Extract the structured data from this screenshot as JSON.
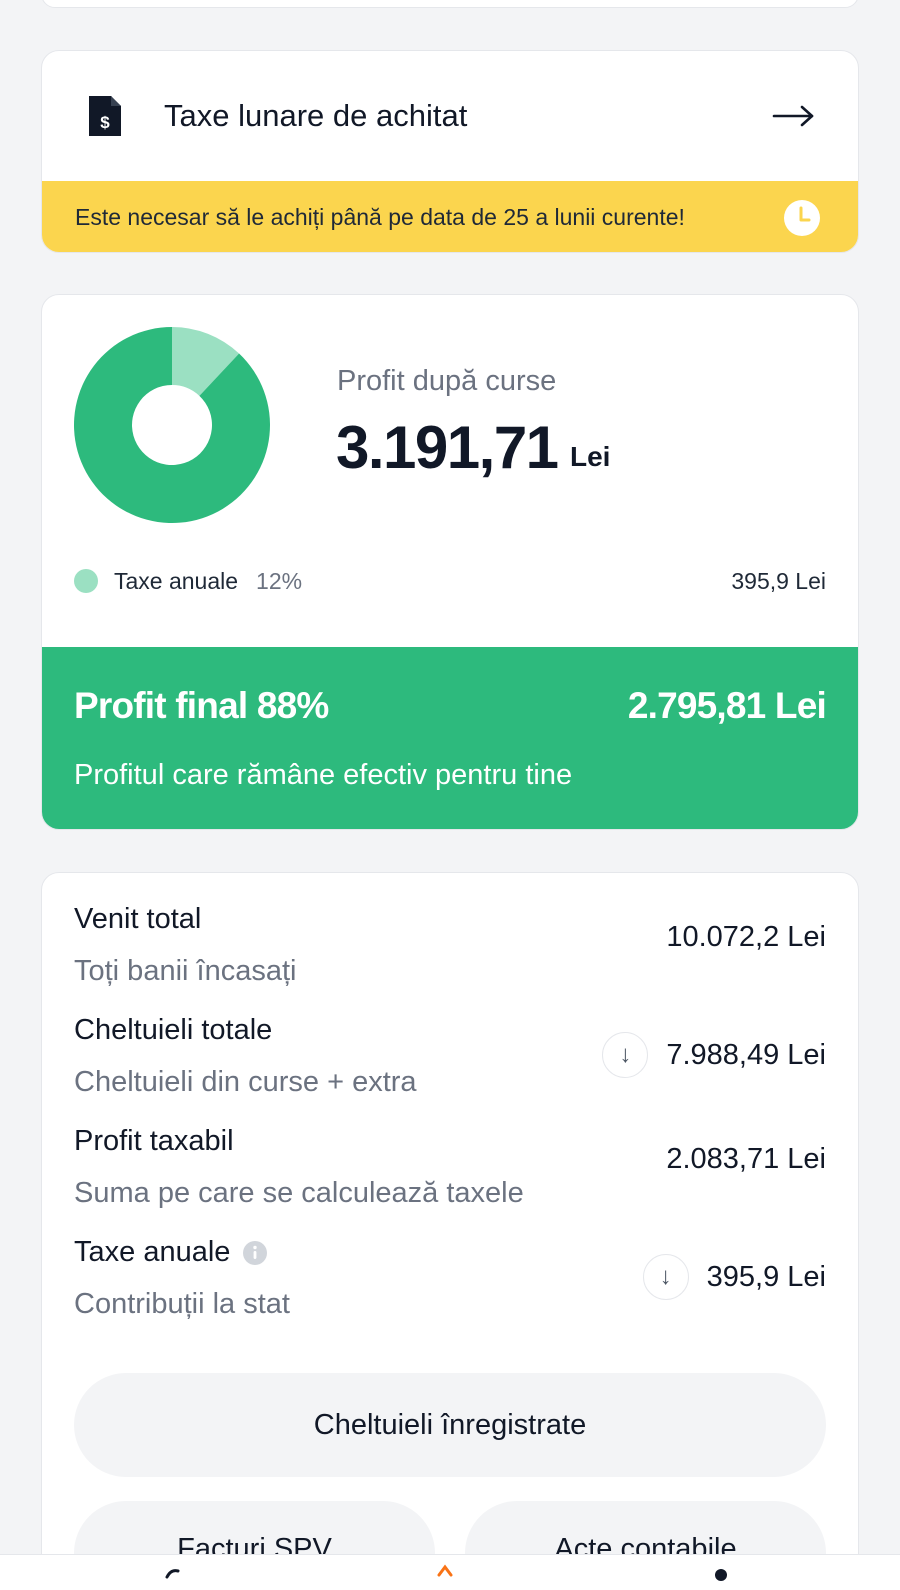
{
  "tax_card": {
    "title": "Taxe lunare de achitat",
    "icon": "dollar-document-icon",
    "warning": "Este necesar să le achiți până pe data de 25 a lunii curente!",
    "warning_icon": "clock-icon",
    "warning_color": "#fbd54e"
  },
  "profit_card": {
    "label": "Profit după curse",
    "amount": "3.191,71",
    "currency": "Lei",
    "chart_data": {
      "type": "pie",
      "slices": [
        {
          "name": "Taxe anuale",
          "value": 12,
          "color": "#9be0c2"
        },
        {
          "name": "Profit final",
          "value": 88,
          "color": "#2dba7d"
        }
      ]
    },
    "legend": {
      "name": "Taxe anuale",
      "percent": "12%",
      "value": "395,9 Lei"
    },
    "final": {
      "title": "Profit final 88%",
      "amount": "2.795,81 Lei",
      "subtitle": "Profitul care rămâne efectiv pentru tine",
      "color": "#2dba7d"
    }
  },
  "summary": {
    "rows": [
      {
        "title": "Venit total",
        "subtitle": "Toți banii încasați",
        "value": "10.072,2 Lei"
      },
      {
        "title": "Cheltuieli totale",
        "subtitle": "Cheltuieli din curse + extra",
        "value": "7.988,49 Lei"
      },
      {
        "title": "Profit taxabil",
        "subtitle": "Suma pe care se calculează taxele",
        "value": "2.083,71 Lei"
      },
      {
        "title": "Taxe anuale",
        "subtitle": "Contribuții la stat",
        "value": "395,9 Lei"
      }
    ],
    "down_arrow": "↓",
    "buttons": {
      "expenses": "Cheltuieli înregistrate",
      "invoices": "Facturi SPV",
      "documents": "Acte contabile"
    }
  }
}
